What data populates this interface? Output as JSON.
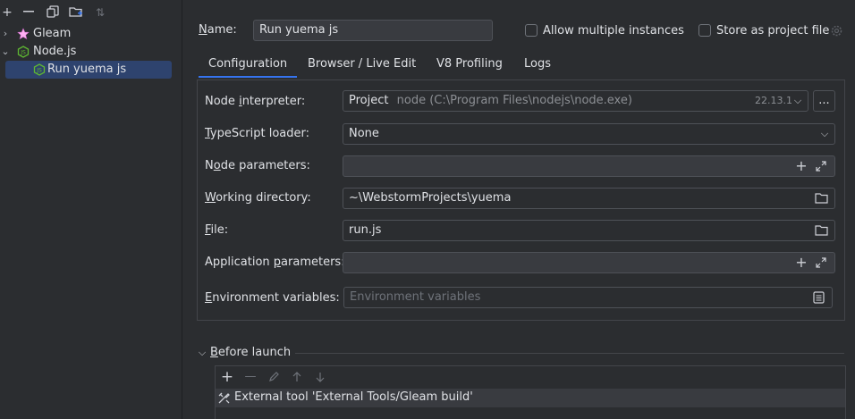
{
  "left_toolbar": {
    "add_icon": "+",
    "remove_icon": "—",
    "copy_icon": "⧉",
    "folder_icon": "📁",
    "sort_icon": "⇅"
  },
  "tree": {
    "gleam_label": "Gleam",
    "node_label": "Node.js",
    "run_label": "Run yuema js"
  },
  "header": {
    "name_label_mnemonic": "N",
    "name_label_rest": "ame:",
    "name_value": "Run yuema js",
    "allow_multiple": "Allow multiple instances",
    "store_as_project": "Store as project file"
  },
  "tabs": [
    "Configuration",
    "Browser / Live Edit",
    "V8 Profiling",
    "Logs"
  ],
  "form": {
    "node_interpreter_label_pre": "Node ",
    "node_interpreter_label_mnemonic": "i",
    "node_interpreter_label_post": "nterpreter:",
    "interpreter_kind": "Project",
    "interpreter_path": "node (C:\\Program Files\\nodejs\\node.exe)",
    "interpreter_version": "22.13.1",
    "browse_button": "...",
    "ts_loader_label_mnemonic": "T",
    "ts_loader_label_rest": "ypeScript loader:",
    "ts_loader_value": "None",
    "node_params_label_pre": "N",
    "node_params_label_mnemonic": "o",
    "node_params_label_post": "de parameters:",
    "node_params_value": "",
    "working_dir_label_mnemonic": "W",
    "working_dir_label_rest": "orking directory:",
    "working_dir_value": "~\\WebstormProjects\\yuema",
    "file_label_mnemonic": "F",
    "file_label_rest": "ile:",
    "file_value": "run.js",
    "app_params_label_pre": "Application ",
    "app_params_label_mnemonic": "p",
    "app_params_label_post": "arameters:",
    "app_params_value": "",
    "env_label_mnemonic": "E",
    "env_label_rest": "nvironment variables:",
    "env_placeholder": "Environment variables"
  },
  "before_launch": {
    "title_mnemonic": "B",
    "title_rest": "efore launch",
    "task": "External tool 'External Tools/Gleam build'"
  },
  "colors": {
    "accent": "#3574f0",
    "selection": "#2e436e",
    "background": "#2b2d30"
  }
}
